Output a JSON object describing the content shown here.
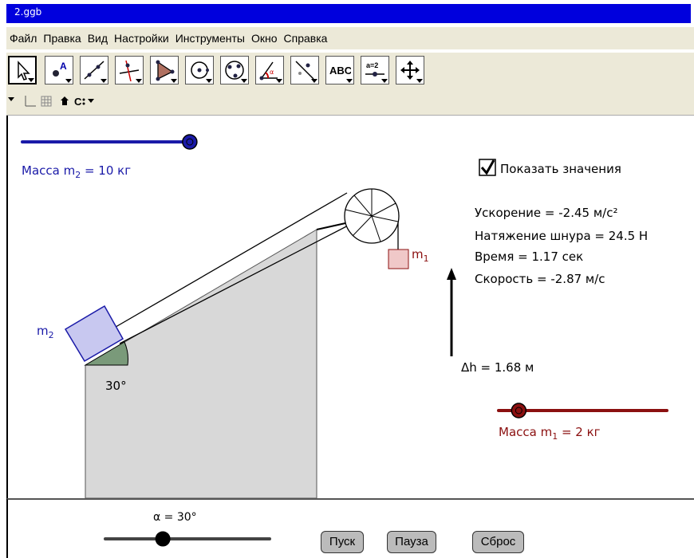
{
  "window": {
    "title": "2.ggb"
  },
  "menu": [
    "Файл",
    "Правка",
    "Вид",
    "Настройки",
    "Инструменты",
    "Окно",
    "Справка"
  ],
  "toolbar": {
    "tools": [
      "move-tool",
      "point-tool",
      "line-tool",
      "perpendicular-tool",
      "polygon-tool",
      "circle-tool",
      "conic-tool",
      "angle-tool",
      "reflect-tool",
      "text-tool",
      "slider-tool",
      "move-graphics-tool"
    ],
    "text_tool_label": "ABC",
    "slider_tool_label": "a=2"
  },
  "sliders": {
    "mass2": {
      "prefix": "Масса m",
      "sub": "2",
      "suffix": " = 10 кг",
      "value": 10,
      "fraction": 1.0,
      "color": "#1a1aa8"
    },
    "mass1": {
      "prefix": "Масса m",
      "sub": "1",
      "suffix": " = 2 кг",
      "value": 2,
      "fraction": 0.12,
      "color": "#8b1010"
    },
    "alpha": {
      "label": "α = 30°",
      "value": 30,
      "fraction": 0.35
    }
  },
  "checkbox": {
    "label": "Показать значения",
    "checked": true
  },
  "values": {
    "acceleration": "Ускорение = -2.45 м/с²",
    "tension": "Натяжение шнура = 24.5 Н",
    "time": "Время = 1.17 сек",
    "speed": "Скорость = -2.87 м/с"
  },
  "labels": {
    "m2": "m",
    "m2_sub": "2",
    "m1": "m",
    "m1_sub": "1",
    "angle": "30°",
    "dh": "Δh = 1.68 м"
  },
  "buttons": {
    "start": "Пуск",
    "pause": "Пауза",
    "reset": "Сброс"
  },
  "colors": {
    "title_bar": "#0000dd",
    "mass2_block": "#c8c8f0",
    "mass1_block": "#f0c8c8",
    "incline_fill": "#d8d8d8",
    "angle_fill": "#7a9a7a"
  }
}
